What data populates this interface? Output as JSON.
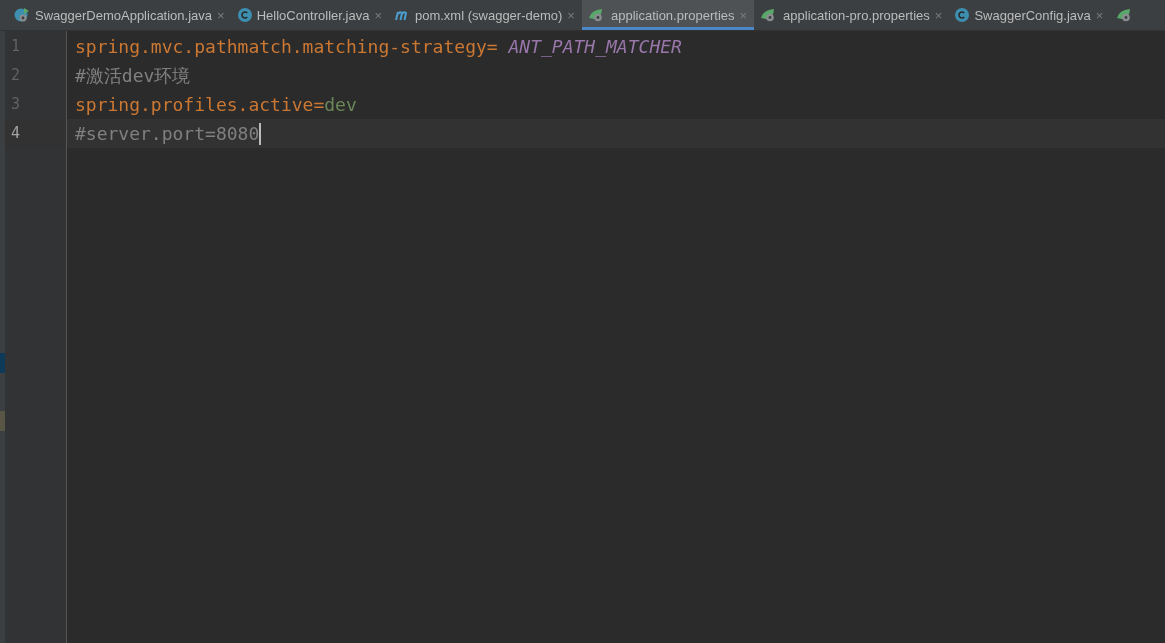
{
  "tabs": [
    {
      "kind": "spring-app",
      "label": "SwaggerDemoApplication.java",
      "close": "×",
      "selected": false
    },
    {
      "kind": "class",
      "label": "HelloController.java",
      "close": "×",
      "selected": false
    },
    {
      "kind": "maven",
      "label": "pom.xml (swagger-demo)",
      "close": "×",
      "selected": false
    },
    {
      "kind": "spring-config",
      "label": "application.properties",
      "close": "×",
      "selected": true
    },
    {
      "kind": "spring-config",
      "label": "application-pro.properties",
      "close": "×",
      "selected": false
    },
    {
      "kind": "class",
      "label": "SwaggerConfig.java",
      "close": "×",
      "selected": false
    },
    {
      "kind": "spring-config",
      "selected": false
    }
  ],
  "editor": {
    "lines": [
      {
        "number": "1",
        "current": false,
        "tokens": [
          {
            "kind": "key",
            "text": "spring.mvc.pathmatch.matching-strategy"
          },
          {
            "kind": "sep",
            "text": "= "
          },
          {
            "kind": "constant",
            "text": "ANT_PATH_MATCHER"
          }
        ]
      },
      {
        "number": "2",
        "current": false,
        "tokens": [
          {
            "kind": "comment",
            "text": "#激活dev环境"
          }
        ]
      },
      {
        "number": "3",
        "current": false,
        "tokens": [
          {
            "kind": "key",
            "text": "spring.profiles.active"
          },
          {
            "kind": "sep",
            "text": "="
          },
          {
            "kind": "value",
            "text": "dev"
          }
        ]
      },
      {
        "number": "4",
        "current": true,
        "tokens": [
          {
            "kind": "comment",
            "text": "#server.port=8080"
          }
        ]
      }
    ]
  }
}
